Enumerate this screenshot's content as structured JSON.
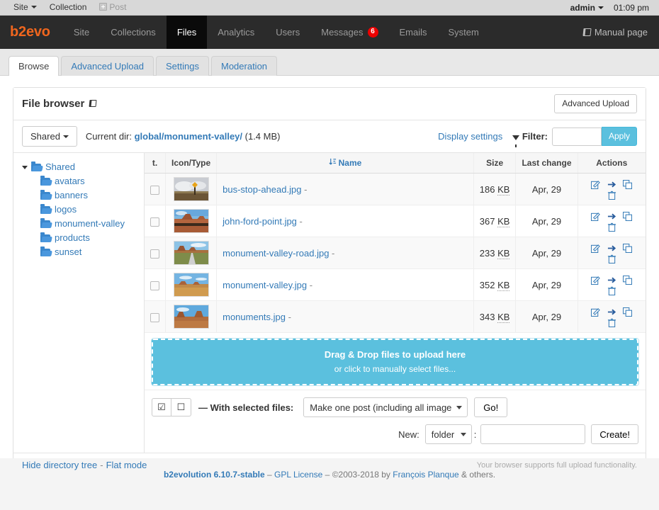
{
  "evobar": {
    "site_label": "Site",
    "collection_label": "Collection",
    "post_label": "Post",
    "user_label": "admin",
    "time": "01:09 pm"
  },
  "mainnav": {
    "brand": "b2evo",
    "items": [
      {
        "label": "Site",
        "active": false
      },
      {
        "label": "Collections",
        "active": false
      },
      {
        "label": "Files",
        "active": true
      },
      {
        "label": "Analytics",
        "active": false
      },
      {
        "label": "Users",
        "active": false
      },
      {
        "label": "Messages",
        "active": false,
        "badge": "6"
      },
      {
        "label": "Emails",
        "active": false
      },
      {
        "label": "System",
        "active": false
      }
    ],
    "manual_label": "Manual page"
  },
  "tabs": [
    {
      "label": "Browse",
      "active": true
    },
    {
      "label": "Advanced Upload",
      "active": false
    },
    {
      "label": "Settings",
      "active": false
    },
    {
      "label": "Moderation",
      "active": false
    }
  ],
  "panel": {
    "title": "File browser",
    "advanced_upload_label": "Advanced Upload",
    "root_button_label": "Shared",
    "current_dir_label": "Current dir:",
    "path_root": "global",
    "path_sep": "/",
    "path_leaf": "monument-valley/",
    "dir_size": "(1.4 MB)",
    "display_settings_label": "Display settings",
    "filter_label": "Filter:",
    "filter_value": "",
    "filter_placeholder": "",
    "apply_label": "Apply"
  },
  "tree": {
    "root": {
      "label": "Shared"
    },
    "items": [
      {
        "label": "avatars"
      },
      {
        "label": "banners"
      },
      {
        "label": "logos"
      },
      {
        "label": "monument-valley"
      },
      {
        "label": "products"
      },
      {
        "label": "sunset"
      }
    ]
  },
  "table": {
    "headers": {
      "select": "t.",
      "icon_type": "Icon/Type",
      "name": "Name",
      "size": "Size",
      "last_change": "Last change",
      "actions": "Actions"
    },
    "rows": [
      {
        "name": "bus-stop-ahead.jpg",
        "trailing": "-",
        "size": "186",
        "size_unit": "KB",
        "date": "Apr, 29",
        "thumb": "bus-stop-ahead"
      },
      {
        "name": "john-ford-point.jpg",
        "trailing": "-",
        "size": "367",
        "size_unit": "KB",
        "date": "Apr, 29",
        "thumb": "john-ford-point"
      },
      {
        "name": "monument-valley-road.jpg",
        "trailing": "-",
        "size": "233",
        "size_unit": "KB",
        "date": "Apr, 29",
        "thumb": "monument-valley-road"
      },
      {
        "name": "monument-valley.jpg",
        "trailing": "-",
        "size": "352",
        "size_unit": "KB",
        "date": "Apr, 29",
        "thumb": "monument-valley"
      },
      {
        "name": "monuments.jpg",
        "trailing": "-",
        "size": "343",
        "size_unit": "KB",
        "date": "Apr, 29",
        "thumb": "monuments"
      }
    ]
  },
  "dropzone": {
    "main": "Drag & Drop files to upload here",
    "sub": "or click to manually select files..."
  },
  "controls": {
    "check_all_glyph": "☑",
    "uncheck_all_glyph": "☐",
    "with_selected_label": "— With selected files:",
    "action_selected": "Make one post (including all images)",
    "action_options": [
      "Make one post (including all images)"
    ],
    "go_label": "Go!",
    "new_label": "New:",
    "new_type_selected": "folder",
    "new_type_options": [
      "folder"
    ],
    "new_colon": ":",
    "new_name_value": "",
    "create_label": "Create!"
  },
  "panel_footer": {
    "hide_tree_label": "Hide directory tree",
    "sep": "-",
    "flat_mode_label": "Flat mode",
    "browser_note": "Your browser supports full upload functionality."
  },
  "footer": {
    "version": "b2evolution 6.10.7-stable",
    "dash1": "–",
    "license": "GPL License",
    "dash2": "–",
    "copyright": "©2003-2018 by",
    "author": "François Planque",
    "others": "& others."
  },
  "colors": {
    "brand_orange": "#f0661e",
    "nav_dark": "#2b2b2b",
    "nav_active": "#0a0a0a",
    "link_blue": "#337ab7",
    "accent_cyan": "#5bc0de",
    "badge_red": "#e00000"
  }
}
